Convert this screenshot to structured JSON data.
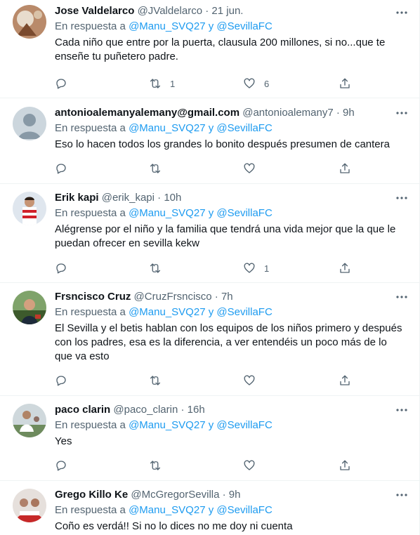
{
  "tweets": [
    {
      "name": "Jose Valdelarco",
      "handle": "@JValdelarco",
      "time": "21 jun.",
      "reply_prefix": "En respuesta a",
      "mention1": "@Manu_SVQ27",
      "and": "y",
      "mention2": "@SevillaFC",
      "text": "Cada niño que entre por la puerta, clausula 200 millones, si no...que te enseñe tu puñetero padre.",
      "replies": "",
      "retweets": "1",
      "likes": "6",
      "avatar_icon": "photo-avatar-icon"
    },
    {
      "name": "antonioalemanyalemany@gmail.com",
      "handle": "@antonioalemany7",
      "time": "9h",
      "reply_prefix": "En respuesta a",
      "mention1": "@Manu_SVQ27",
      "and": "y",
      "mention2": "@SevillaFC",
      "text": "Eso lo hacen todos los grandes lo bonito después presumen de cantera",
      "replies": "",
      "retweets": "",
      "likes": "",
      "avatar_icon": "default-avatar-icon"
    },
    {
      "name": "Erik kapi",
      "handle": "@erik_kapi",
      "time": "10h",
      "reply_prefix": "En respuesta a",
      "mention1": "@Manu_SVQ27",
      "and": "y",
      "mention2": "@SevillaFC",
      "text": "Alégrense por el niño y la familia que tendrá una vida mejor que la que le puedan ofrecer en sevilla kekw",
      "replies": "",
      "retweets": "",
      "likes": "1",
      "avatar_icon": "photo-avatar-icon"
    },
    {
      "name": "Frsncisco Cruz",
      "handle": "@CruzFrsncisco",
      "time": "7h",
      "reply_prefix": "En respuesta a",
      "mention1": "@Manu_SVQ27",
      "and": "y",
      "mention2": "@SevillaFC",
      "text": "El Sevilla y el betis hablan con los equipos de los niños primero y después con los padres, esa es la diferencia, a ver entendéis un poco más de lo que va esto",
      "replies": "",
      "retweets": "",
      "likes": "",
      "avatar_icon": "photo-avatar-icon"
    },
    {
      "name": "paco clarin",
      "handle": "@paco_clarin",
      "time": "16h",
      "reply_prefix": "En respuesta a",
      "mention1": "@Manu_SVQ27",
      "and": "y",
      "mention2": "@SevillaFC",
      "text": "Yes",
      "replies": "",
      "retweets": "",
      "likes": "",
      "avatar_icon": "photo-avatar-icon"
    },
    {
      "name": "Grego Killo Ke",
      "handle": "@McGregorSevilla",
      "time": "9h",
      "reply_prefix": "En respuesta a",
      "mention1": "@Manu_SVQ27",
      "and": "y",
      "mention2": "@SevillaFC",
      "text": "Coño es verdá!! Si no lo dices no me doy ni cuenta",
      "replies": "",
      "retweets": "",
      "likes": "",
      "avatar_icon": "photo-avatar-icon"
    }
  ],
  "colors": {
    "link": "#1d9bf0",
    "secondary_text": "#536471",
    "primary_text": "#0f1419",
    "border": "#eff3f4"
  }
}
